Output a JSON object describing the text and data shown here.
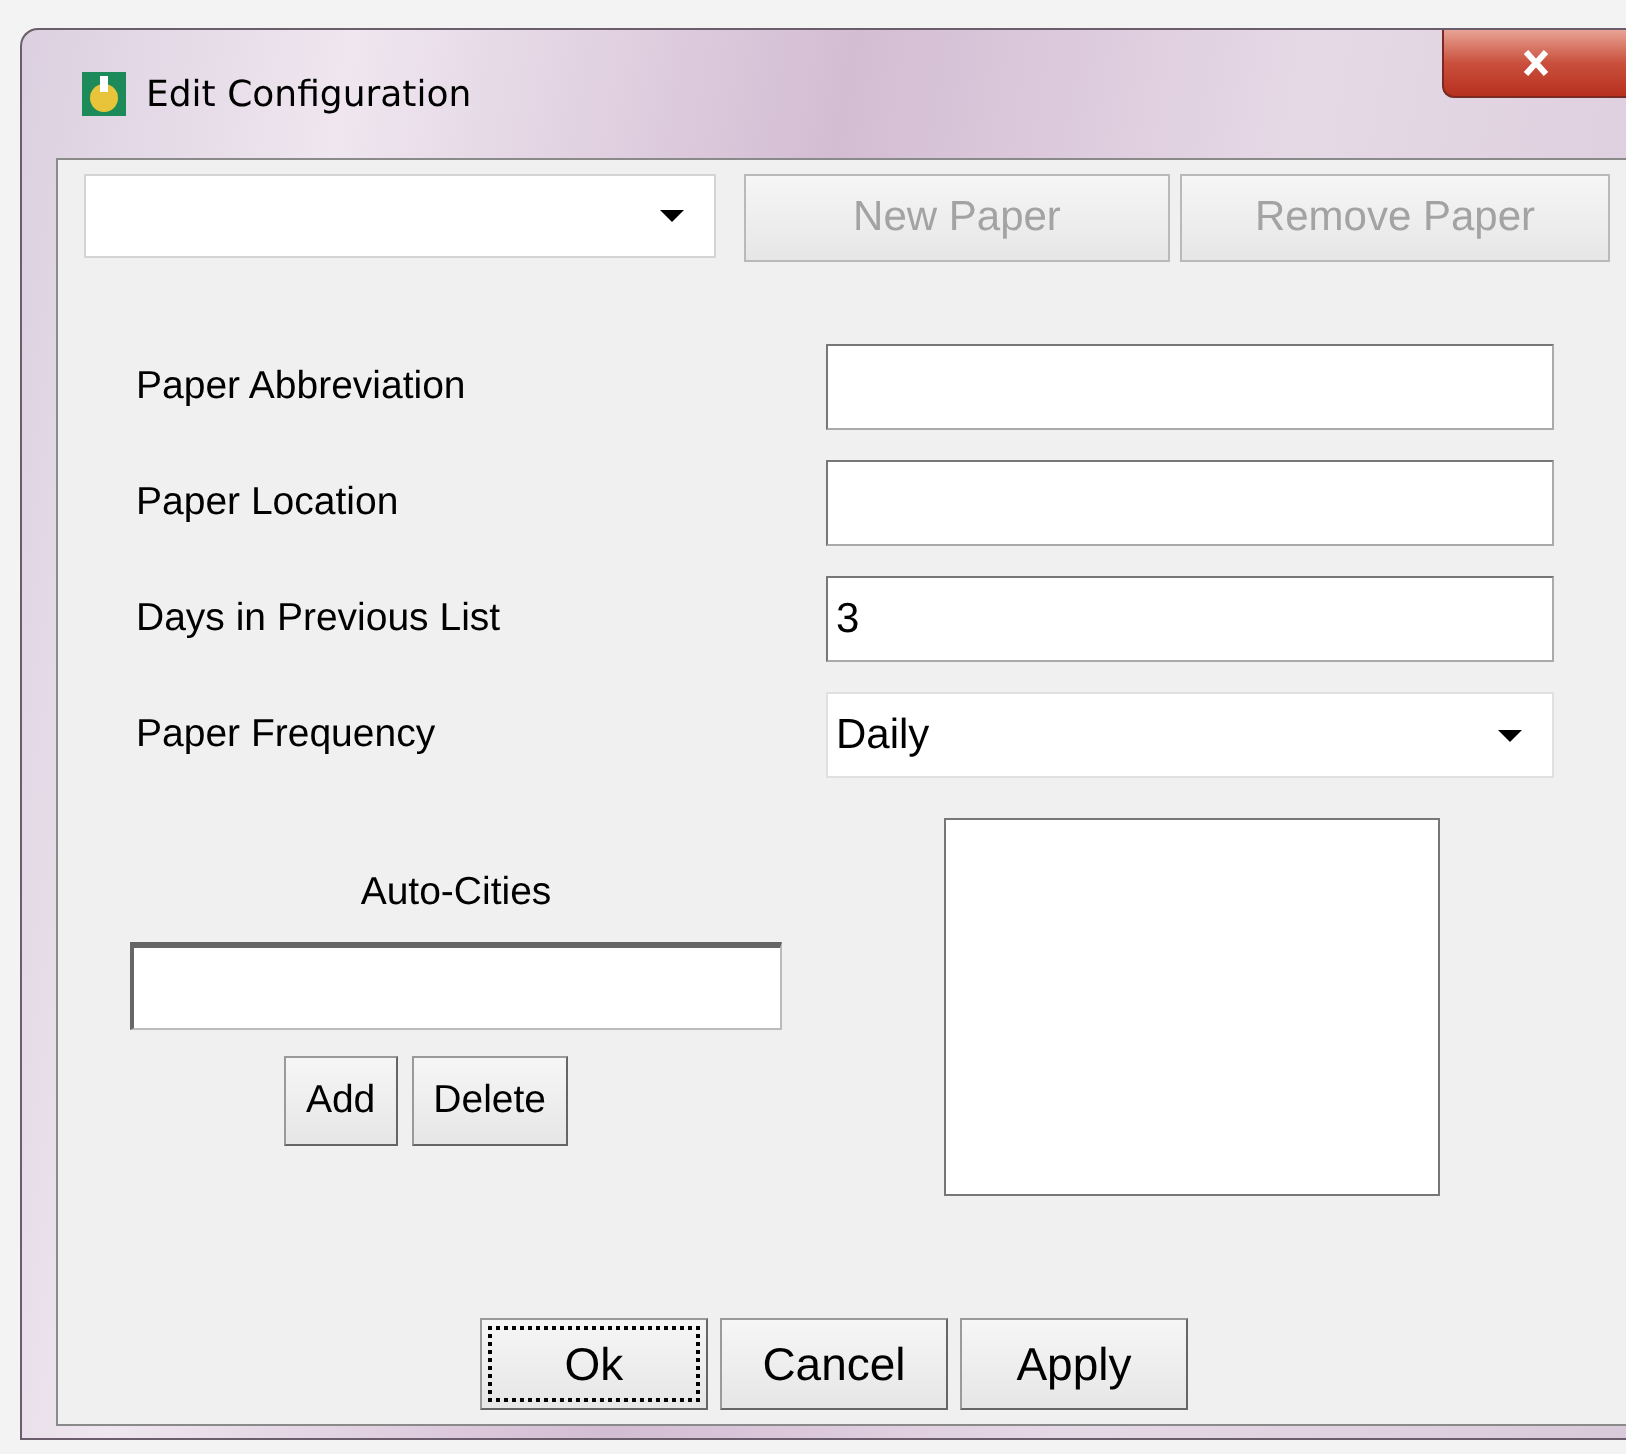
{
  "window": {
    "title": "Edit Configuration"
  },
  "toolbar": {
    "buttons": [
      {
        "label": "New Paper",
        "disabled": true
      },
      {
        "label": "Remove Paper",
        "disabled": true
      }
    ]
  },
  "fields": [
    {
      "label": "Paper Abbreviation",
      "kind": "text"
    },
    {
      "label": "Paper Location",
      "kind": "text"
    },
    {
      "label": "Days in Previous List",
      "kind": "text",
      "value": "3"
    },
    {
      "label": "Paper Frequency",
      "kind": "dropdown",
      "value": "Daily"
    }
  ],
  "auto_cities": {
    "label": "Auto-Cities",
    "buttons": [
      "Add",
      "Delete"
    ]
  },
  "footer_buttons": [
    {
      "label": "Ok",
      "focused": true
    },
    {
      "label": "Cancel",
      "focused": false
    },
    {
      "label": "Apply",
      "focused": false
    }
  ]
}
